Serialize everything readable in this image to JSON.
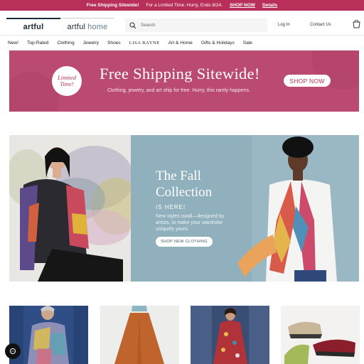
{
  "promo_bar": {
    "headline": "Free Shipping Sitewide!",
    "details": "For a Limited Time. Hurry, Ends 8/24.",
    "shop_now": "SHOP NOW",
    "details_link": "Details"
  },
  "header": {
    "tab_artful": "artful",
    "tab_artful_home_a": "artful",
    "tab_artful_home_b": "home",
    "search_placeholder": "Search",
    "login": "Log In",
    "contact": "Contact Us"
  },
  "nav": {
    "items": [
      "New!",
      "Top-Rated",
      "Clothing",
      "Jewelry",
      "Shoes",
      "LISA BAYNE",
      "Art & Home",
      "Gifts & Holidays",
      "Sale"
    ]
  },
  "banner": {
    "badge_line1": "Limited",
    "badge_line2": "Time!",
    "title": "Free Shipping Sitewide!",
    "subtitle": "Clothing, jewelry, and art ship for free. Hurry, this rarely happens.",
    "button": "SHOP NOW"
  },
  "hero": {
    "title_line1": "The Fall",
    "title_line2": "Collection",
    "here": "IS HERE!",
    "description": "New styles swall—designed by artists, to make your wardrobe uniquely yours.",
    "button": "SHOP NEW CLOTHING"
  },
  "colors": {
    "brand": "#b8305a",
    "banner_bg": "#b8466e",
    "hero_bg": "#8fb0bc",
    "navy": "#1a2a36"
  }
}
